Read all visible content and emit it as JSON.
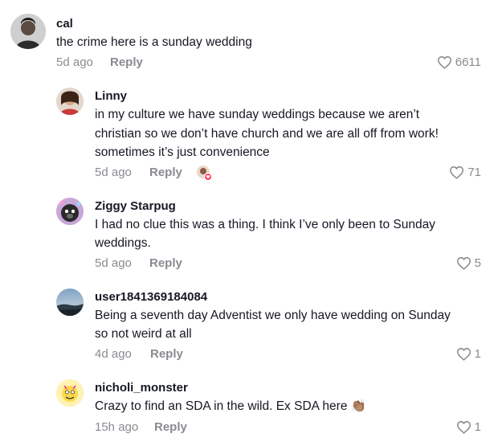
{
  "comments": [
    {
      "username": "cal",
      "lines": [
        "the crime here is a sunday wedding"
      ],
      "time": "5d ago",
      "reply": "Reply",
      "likes": "6611"
    },
    {
      "username": "Linny",
      "lines": [
        "in my culture we have sunday weddings because we aren’t",
        "christian so we don’t have church and we are all off from work!",
        "sometimes it’s just convenience"
      ],
      "time": "5d ago",
      "reply": "Reply",
      "likes": "71",
      "liked_by_creator": true
    },
    {
      "username": "Ziggy Starpug",
      "lines": [
        "I had no clue this was a thing. I think I’ve only been to Sunday",
        "weddings."
      ],
      "time": "5d ago",
      "reply": "Reply",
      "likes": "5"
    },
    {
      "username": "user1841369184084",
      "lines": [
        "Being a seventh day Adventist we only have wedding on Sunday",
        "so not weird at all"
      ],
      "time": "4d ago",
      "reply": "Reply",
      "likes": "1"
    },
    {
      "username": "nicholi_monster",
      "lines": [
        "Crazy to find an SDA in the wild. Ex SDA here 👏🏽"
      ],
      "time": "15h ago",
      "reply": "Reply",
      "likes": "1"
    }
  ],
  "icons": {
    "like": "heart-outline-icon",
    "creator": "creator-liked-badge-icon"
  },
  "colors": {
    "text": "#161823",
    "muted": "#8a8b91",
    "creator_badge": "#fe2c55"
  }
}
